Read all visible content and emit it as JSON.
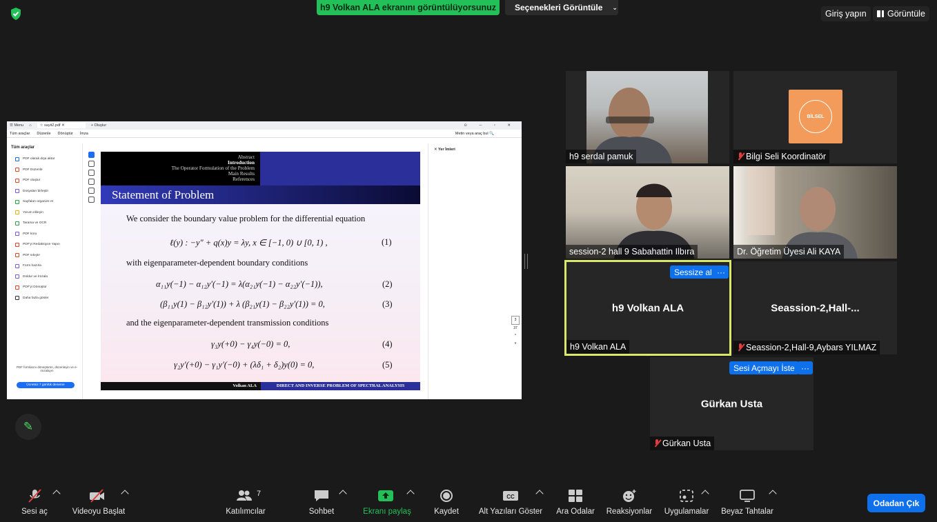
{
  "topbar": {
    "share_banner": "h9 Volkan ALA ekranını görüntülüyorsunuz",
    "view_options": "Seçenekleri Görüntüle",
    "login": "Giriş yapın",
    "view": "Görüntüle"
  },
  "pdf": {
    "menu_label": "Menu",
    "tab_title": "sayit2.pdf",
    "new_tab": "Oluştur",
    "menu": [
      "Tüm araçlar",
      "Düzenle",
      "Dönüştür",
      "İmza"
    ],
    "search_placeholder": "Metin veya araç bul",
    "panel_title": "Tüm araçlar",
    "tools": [
      "PDF olarak dışa aktar",
      "PDF Düzenle",
      "PDF oluştur",
      "Dosyaları birleştir",
      "Sayfaları organize et",
      "Yorum ekleyin",
      "Tarama ve OCR",
      "PDF koru",
      "PDF'yi Redaksiyon Yapın",
      "PDF sıkıştır",
      "Form hazırla",
      "Doldur ve İmzala",
      "PDF'yi Dönüştür",
      "Daha fazla göster"
    ],
    "footer_text": "PDF formlarını dönüştürün, düzenleyin ve e-imzalayın",
    "trial_button": "Ücretsiz 7 günlük deneme",
    "bookmarks_title": "Yer İmleri",
    "page_current": "3",
    "page_total": "37"
  },
  "slide": {
    "nav": [
      "Abstract",
      "Introduction",
      "The Operator Formulation of the Problem",
      "Main Results",
      "References"
    ],
    "title": "Statement of Problem",
    "intro": "We consider the boundary value problem for the differential equation",
    "eq1": "ℓ(y) : −y″ + q(x)y = λy,  x ∈ [−1, 0) ∪ [0, 1) ,",
    "eq1_num": "(1)",
    "text2": "with eigenparameter-dependent boundary conditions",
    "eq2": "α₁₁y(−1) − α₁₂y′(−1) = λ(α₂₁y(−1) − α₂₂y′(−1)),",
    "eq2_num": "(2)",
    "eq3": "(β₁₁y(1) − β₁₂y′(1)) + λ (β₂₁y(1) − β₂₂y′(1)) = 0,",
    "eq3_num": "(3)",
    "text3": "and the eigenparameter-dependent transmission conditions",
    "eq4": "γ₃y(+0) − γ₄y(−0) = 0,",
    "eq4_num": "(4)",
    "eq5": "γ₂y′(+0) − γ₁y′(−0) + (λδ₁ + δ₂)y(0) = 0,",
    "eq5_num": "(5)",
    "footer_author": "Volkan ALA",
    "footer_title": "DIRECT AND INVERSE PROBLEM OF SPECTRAL ANALYSIS"
  },
  "participants": {
    "serdal": "h9 serdal pamuk",
    "bilgi": "Bilgi Seli Koordinatör",
    "bilgi_logo": "BİLSEL",
    "session2": "session-2 hall 9 Sabahattin Ilbıra",
    "ali": "Dr. Öğretim Üyesi Ali KAYA",
    "volkan_big": "h9 Volkan ALA",
    "volkan_label": "h9 Volkan ALA",
    "mute_button": "Sessize al",
    "seassion_big": "Seassion-2,Hall-...",
    "seassion_label": "Seassion-2,Hall-9,Aybars YILMAZ",
    "unmute_request": "Sesi Açmayı İste",
    "gurkan_big": "Gürkan Usta",
    "gurkan_label": "Gürkan Usta",
    "more": "···"
  },
  "toolbar": {
    "audio": "Sesi aç",
    "video": "Videoyu Başlat",
    "participants": "Katılımcılar",
    "participants_count": "7",
    "chat": "Sohbet",
    "share": "Ekranı paylaş",
    "record": "Kaydet",
    "captions": "Alt Yazıları Göster",
    "breakout": "Ara Odalar",
    "reactions": "Reaksiyonlar",
    "apps": "Uygulamalar",
    "whiteboard": "Beyaz Tahtalar",
    "leave": "Odadan Çık"
  },
  "colors": {
    "share_green": "#23c05a",
    "accent_blue": "#0e71eb",
    "active_speaker": "#d9e76b",
    "muted_red": "#e03e3e"
  }
}
